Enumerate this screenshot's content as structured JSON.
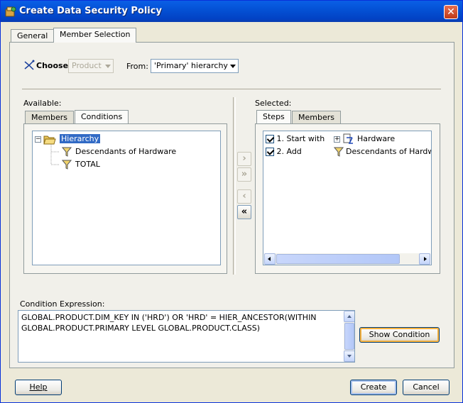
{
  "window": {
    "title": "Create Data Security Policy",
    "close": "✕"
  },
  "tabs": [
    {
      "label": "General",
      "active": false
    },
    {
      "label": "Member Selection",
      "active": true
    }
  ],
  "choose": {
    "label": "Choose",
    "dimension_value": "Product",
    "from_label": "From:",
    "hierarchy_value": "'Primary' hierarchy"
  },
  "available": {
    "label": "Available:",
    "tabs": [
      {
        "label": "Members",
        "active": false
      },
      {
        "label": "Conditions",
        "active": true
      }
    ],
    "tree": {
      "toggle": "−",
      "root": "Hierarchy",
      "children": [
        "Descendants of Hardware",
        "TOTAL"
      ]
    }
  },
  "move_buttons": {
    "add": "›",
    "add_all": "»",
    "remove": "‹",
    "remove_all": "«"
  },
  "selected": {
    "label": "Selected:",
    "tabs": [
      {
        "label": "Steps",
        "active": true
      },
      {
        "label": "Members",
        "active": false
      }
    ],
    "steps": [
      {
        "step": "1. Start with",
        "toggle": "+",
        "target": "Hardware",
        "checked": true
      },
      {
        "step": "2. Add",
        "toggle": "",
        "target": "Descendants of Hardw",
        "checked": true
      }
    ]
  },
  "condition": {
    "label": "Condition Expression:",
    "lines": [
      "GLOBAL.PRODUCT.DIM_KEY IN ('HRD') OR 'HRD' = HIER_ANCESTOR(WITHIN",
      "GLOBAL.PRODUCT.PRIMARY LEVEL GLOBAL.PRODUCT.CLASS)"
    ],
    "show_button": "Show Condition"
  },
  "footer": {
    "help": "Help",
    "create": "Create",
    "cancel": "Cancel"
  },
  "colors": {
    "title_bar": "#0452d6",
    "selection": "#316ac5",
    "close": "#c13a17",
    "focus": "#f8b33f"
  }
}
